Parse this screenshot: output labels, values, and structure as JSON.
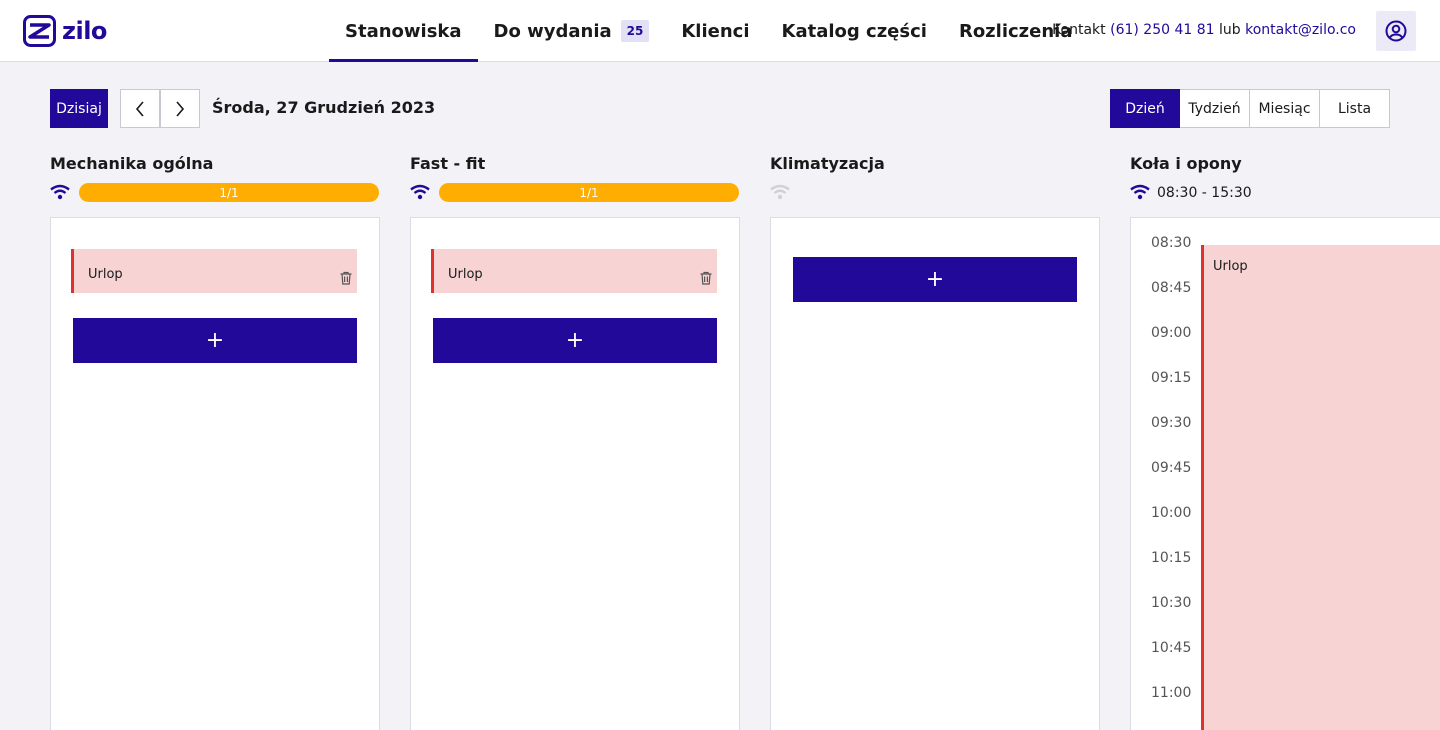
{
  "brand": {
    "name": "zilo",
    "color": "#22099a"
  },
  "nav": [
    {
      "label": "Stanowiska",
      "active": true
    },
    {
      "label": "Do wydania",
      "badge": "25"
    },
    {
      "label": "Klienci"
    },
    {
      "label": "Katalog części"
    },
    {
      "label": "Rozliczenia"
    }
  ],
  "contact": {
    "prefix": "Kontakt",
    "phone": "(61) 250 41 81",
    "separator": "lub",
    "email": "kontakt@zilo.co"
  },
  "user_icon": "user-circle-icon",
  "toolbar": {
    "today_label": "Dzisiaj",
    "prev_icon": "chevron-left-icon",
    "next_icon": "chevron-right-icon",
    "date": "Środa, 27 Grudzień 2023",
    "views": [
      "Dzień",
      "Tydzień",
      "Miesiąc",
      "Lista"
    ],
    "active_view": "Dzień"
  },
  "columns": [
    {
      "title": "Mechanika ogólna",
      "online": true,
      "progress": {
        "label": "1/1",
        "value": 1.0
      },
      "events": [
        {
          "label": "Urlop"
        }
      ],
      "add_label": "+"
    },
    {
      "title": "Fast - fit",
      "online": true,
      "progress": {
        "label": "1/1",
        "value": 1.0
      },
      "events": [
        {
          "label": "Urlop"
        }
      ],
      "add_label": "+"
    },
    {
      "title": "Klimatyzacja",
      "online": false,
      "events": [],
      "add_label": "+"
    },
    {
      "title": "Koła i opony",
      "online": true,
      "hours": "08:30 - 15:30",
      "times": [
        "08:30",
        "08:45",
        "09:00",
        "09:15",
        "09:30",
        "09:45",
        "10:00",
        "10:15",
        "10:30",
        "10:45",
        "11:00"
      ],
      "events": [
        {
          "label": "Urlop"
        }
      ]
    }
  ],
  "colors": {
    "primary": "#22099a",
    "progress": "#ffad00",
    "event_bg": "#f7d3d3",
    "event_border": "#e0322c",
    "offline": "#c8c8d0"
  }
}
